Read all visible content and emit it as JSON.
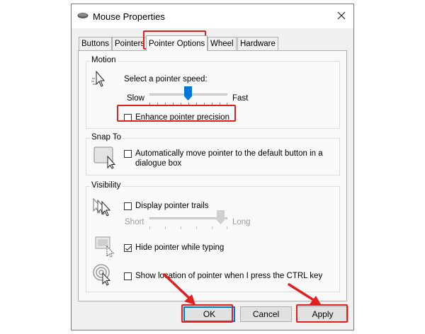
{
  "window": {
    "title": "Mouse Properties",
    "close_icon": "close-icon",
    "app_icon": "mouse-icon"
  },
  "tabs": [
    {
      "label": "Buttons",
      "active": false
    },
    {
      "label": "Pointers",
      "active": false
    },
    {
      "label": "Pointer Options",
      "active": true
    },
    {
      "label": "Wheel",
      "active": false
    },
    {
      "label": "Hardware",
      "active": false
    }
  ],
  "motion": {
    "group_label": "Motion",
    "speed_label": "Select a pointer speed:",
    "slow_label": "Slow",
    "fast_label": "Fast",
    "speed_level": 0.5,
    "precision_label": "Enhance pointer precision",
    "precision_checked": false
  },
  "snap_to": {
    "group_label": "Snap To",
    "auto_move_label_line1": "Automatically move pointer to the default button in a",
    "auto_move_label_line2": "dialogue box",
    "auto_move_checked": false
  },
  "visibility": {
    "group_label": "Visibility",
    "trails_label": "Display pointer trails",
    "trails_checked": false,
    "short_label": "Short",
    "long_label": "Long",
    "trail_length_level": 1.0,
    "hide_label": "Hide pointer while typing",
    "hide_checked": true,
    "show_location_label": "Show location of pointer when I press the CTRL key",
    "show_location_checked": false
  },
  "buttons": {
    "ok": "OK",
    "cancel": "Cancel",
    "apply": "Apply"
  },
  "annotations": {
    "highlight_color": "#e0201e",
    "accent_color": "#0078d7"
  }
}
